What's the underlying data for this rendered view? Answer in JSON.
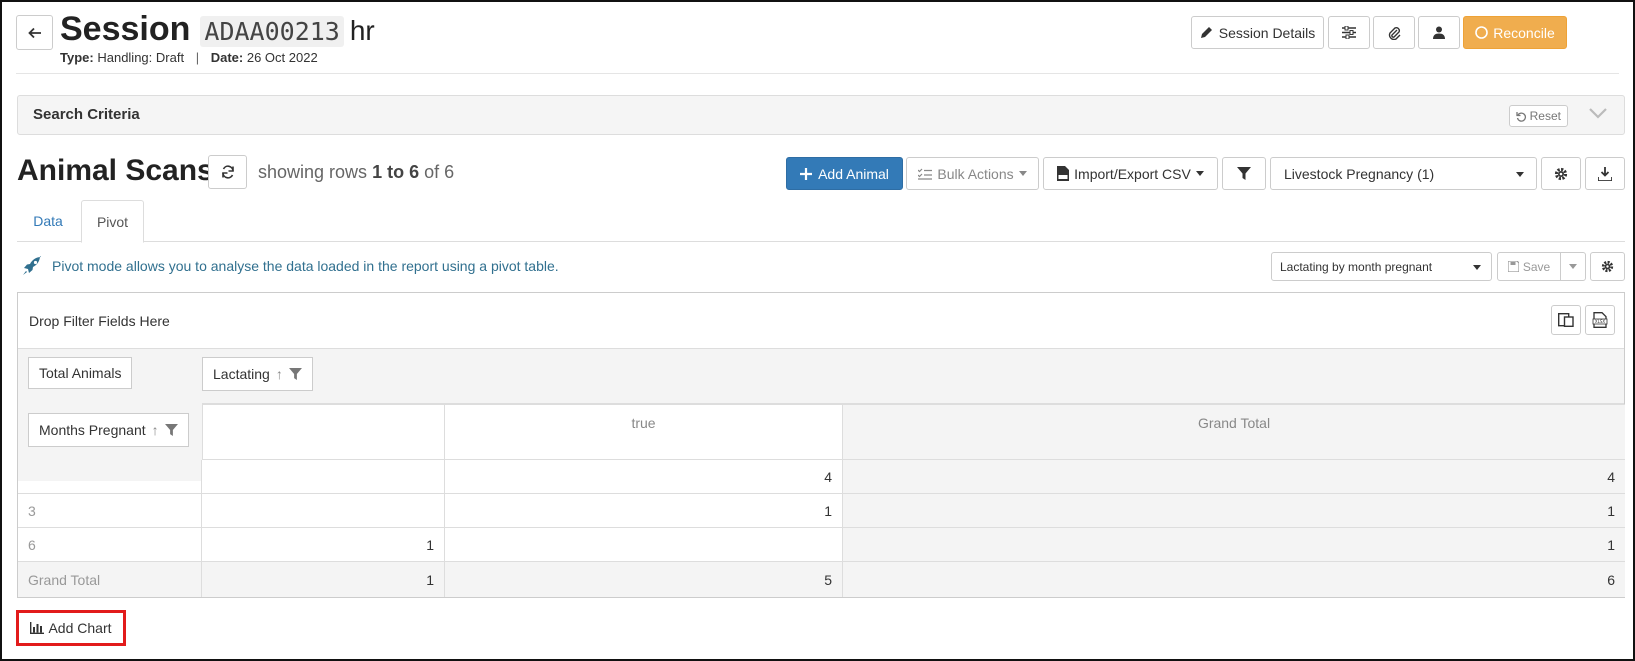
{
  "header": {
    "title_word": "Session",
    "session_code": "ADAA00213",
    "title_suffix": "hr",
    "type_label": "Type:",
    "type_value": "Handling: Draft",
    "date_label": "Date:",
    "date_value": "26 Oct 2022",
    "session_details_label": "Session Details",
    "reconcile_label": "Reconcile"
  },
  "search": {
    "title": "Search Criteria",
    "reset_label": "Reset"
  },
  "section": {
    "title": "Animal Scans",
    "showing_prefix": "showing rows",
    "showing_range": "1 to 6",
    "showing_of": "of 6",
    "add_animal_label": "Add Animal",
    "bulk_actions_label": "Bulk Actions",
    "import_export_label": "Import/Export CSV",
    "report_select_value": "Livestock Pregnancy (1)"
  },
  "tabs": [
    {
      "label": "Data",
      "active": false
    },
    {
      "label": "Pivot",
      "active": true
    }
  ],
  "pivot_info": {
    "message": "Pivot mode allows you to analyse the data loaded in the report using a pivot table.",
    "layout_select_value": "Lactating by month pregnant",
    "save_label": "Save"
  },
  "pivot": {
    "filter_zone_label": "Drop Filter Fields Here",
    "value_field": "Total Animals",
    "column_field": "Lactating",
    "row_field": "Months Pregnant",
    "column_headers": [
      "",
      "true",
      "Grand Total"
    ],
    "rows": [
      {
        "label": "",
        "values": [
          "",
          "4",
          "4"
        ]
      },
      {
        "label": "3",
        "values": [
          "",
          "1",
          "1"
        ]
      },
      {
        "label": "6",
        "values": [
          "1",
          "",
          "1"
        ]
      },
      {
        "label": "Grand Total",
        "values": [
          "1",
          "5",
          "6"
        ]
      }
    ]
  },
  "add_chart_label": "Add Chart",
  "colors": {
    "primary": "#337ab7",
    "warning": "#f0ad4e",
    "info_text": "#31708f",
    "highlight_border": "#e21b1b"
  }
}
